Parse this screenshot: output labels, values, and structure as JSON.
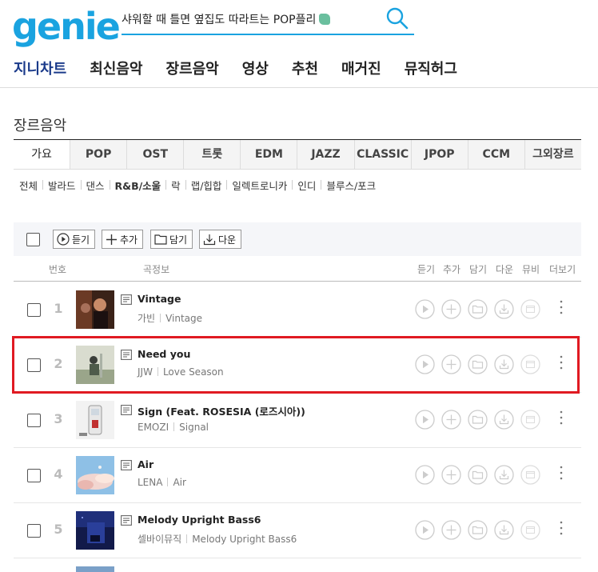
{
  "header": {
    "logo": "genie",
    "search_value": "샤워할 때 틀면 옆집도 따라트는 POP플리",
    "search_icon": "search-icon"
  },
  "gnb": [
    "지니차트",
    "최신음악",
    "장르음악",
    "영상",
    "추천",
    "매거진",
    "뮤직허그"
  ],
  "page_title": "장르음악",
  "genre_tabs": [
    "가요",
    "POP",
    "OST",
    "트롯",
    "EDM",
    "JAZZ",
    "CLASSIC",
    "JPOP",
    "CCM",
    "그외장르"
  ],
  "sub_genres": [
    "전체",
    "발라드",
    "댄스",
    "R&B/소울",
    "락",
    "랩/힙합",
    "일렉트로니카",
    "인디",
    "블루스/포크"
  ],
  "toolbar": {
    "play_label": "듣기",
    "add_label": "추가",
    "save_label": "담기",
    "download_label": "다운"
  },
  "columns": {
    "rank": "번호",
    "info": "곡정보",
    "play": "듣기",
    "add": "추가",
    "save": "담기",
    "download": "다운",
    "mv": "뮤비",
    "more": "더보기"
  },
  "songs": [
    {
      "rank": "1",
      "title": "Vintage",
      "artist": "가빈",
      "album": "Vintage"
    },
    {
      "rank": "2",
      "title": "Need you",
      "artist": "JJW",
      "album": "Love Season"
    },
    {
      "rank": "3",
      "title": "Sign (Feat. ROSESIA (로즈시아))",
      "artist": "EMOZI",
      "album": "Signal"
    },
    {
      "rank": "4",
      "title": "Air",
      "artist": "LENA",
      "album": "Air"
    },
    {
      "rank": "5",
      "title": "Melody Upright Bass6",
      "artist": "셀바이뮤직",
      "album": "Melody Upright Bass6"
    }
  ],
  "colors": {
    "brand": "#1aa3e0",
    "highlight": "#e01a22"
  }
}
